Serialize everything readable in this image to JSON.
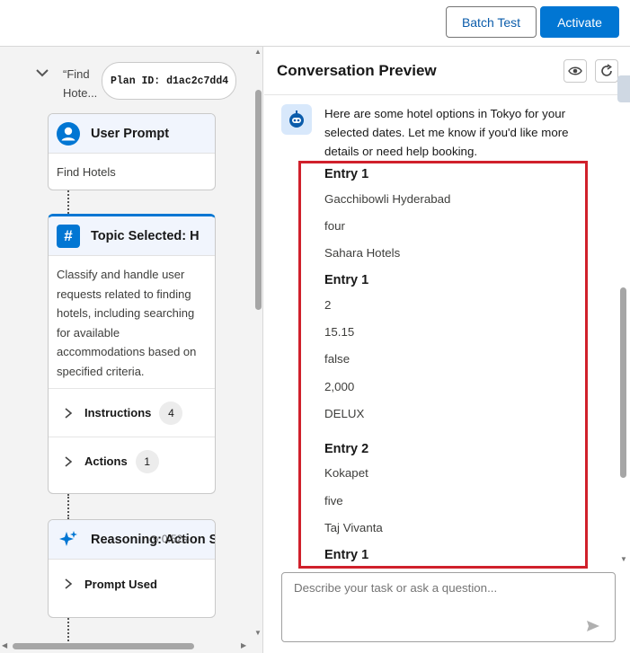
{
  "toolbar": {
    "batch_test_label": "Batch Test",
    "activate_label": "Activate"
  },
  "left": {
    "crumb_text": "“Find Hote...",
    "plan_id": "Plan ID: d1ac2c7dd4",
    "cards": {
      "user_prompt": {
        "title": "User Prompt",
        "body": "Find Hotels"
      },
      "topic": {
        "title": "Topic Selected: H",
        "body": "Classify and handle user requests related to finding hotels, including searching for available accommodations based on specified criteria.",
        "instructions_label": "Instructions",
        "instructions_count": "4",
        "actions_label": "Actions",
        "actions_count": "1"
      },
      "reasoning": {
        "title": "Reasoning: Action S",
        "time": "0.52s",
        "prompt_used_label": "Prompt Used"
      }
    }
  },
  "conversation": {
    "title": "Conversation Preview",
    "bot_message": "Here are some hotel options in Tokyo for your selected dates. Let me know if you'd like more details or need help booking.",
    "entries": [
      {
        "heading": "Entry 1",
        "values": [
          "Gacchibowli Hyderabad",
          "four",
          "Sahara Hotels"
        ]
      },
      {
        "heading": "Entry 1",
        "values": [
          "2",
          "15.15",
          "false",
          "2,000",
          "DELUX"
        ]
      },
      {
        "heading": "Entry 2",
        "values": [
          "Kokapet",
          "five",
          "Taj Vivanta"
        ]
      },
      {
        "heading": "Entry 1",
        "values": []
      }
    ],
    "input_placeholder": "Describe your task or ask a question..."
  },
  "icons": {
    "crumb": "chevron-down-icon",
    "user": "user-icon",
    "topic": "hash-icon",
    "reasoning": "sparkle-icon",
    "preview": "eye-icon",
    "refresh": "refresh-icon",
    "send": "send-icon",
    "bot": "bot-avatar-icon"
  },
  "colors": {
    "brand": "#0176d3",
    "highlight": "#d0202b",
    "card_header": "#f1f5fd"
  }
}
